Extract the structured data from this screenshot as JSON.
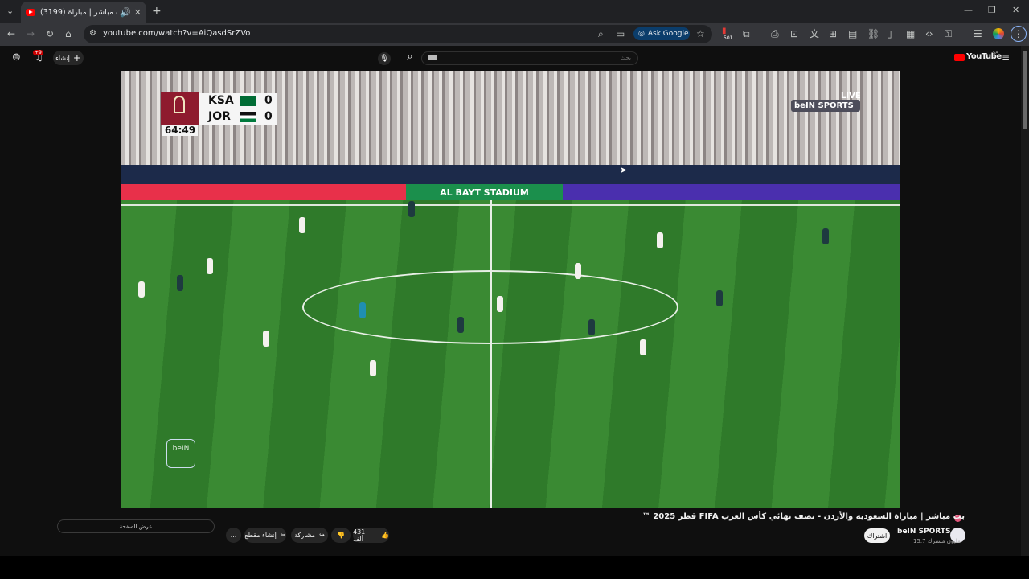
{
  "browser": {
    "tab_title": "(3199) بث مباشر | مباراة",
    "url": "youtube.com/watch?v=AiQasdSrZVo",
    "ask_google": "Ask Google",
    "badge_count": "501"
  },
  "youtube": {
    "logo": "YouTube",
    "create_label": "إنشاء",
    "notifications": "+9",
    "search_placeholder": "بحث",
    "region": "SA"
  },
  "video": {
    "scoreboard": {
      "home_team": "KSA",
      "home_score": "0",
      "away_team": "JOR",
      "away_score": "0",
      "clock": "64:49"
    },
    "live_label": "LIVE",
    "broadcaster": "beIN SPORTS",
    "stadium": "AL BAYT STADIUM",
    "connect_label": "beIN"
  },
  "details": {
    "title": "بث مباشر | مباراة السعودية والأردن - نصف نهائي كأس العرب FIFA قطر 2025 ™",
    "channel": "beIN SPORTS",
    "subscribers": "15.7 مليون مشترك",
    "subscribe_label": "اشتراك",
    "likes": "431 ألف",
    "share_label": "مشاركة",
    "clip_label": "إنشاء مقطع",
    "show_page_label": "عرض الصفحة",
    "more_label": "..."
  },
  "colors": {
    "youtube_red": "#ff0000",
    "pitch_green": "#3a8a33",
    "ksa_flag": "#006c35",
    "qatar_maroon": "#8e1b2e"
  }
}
